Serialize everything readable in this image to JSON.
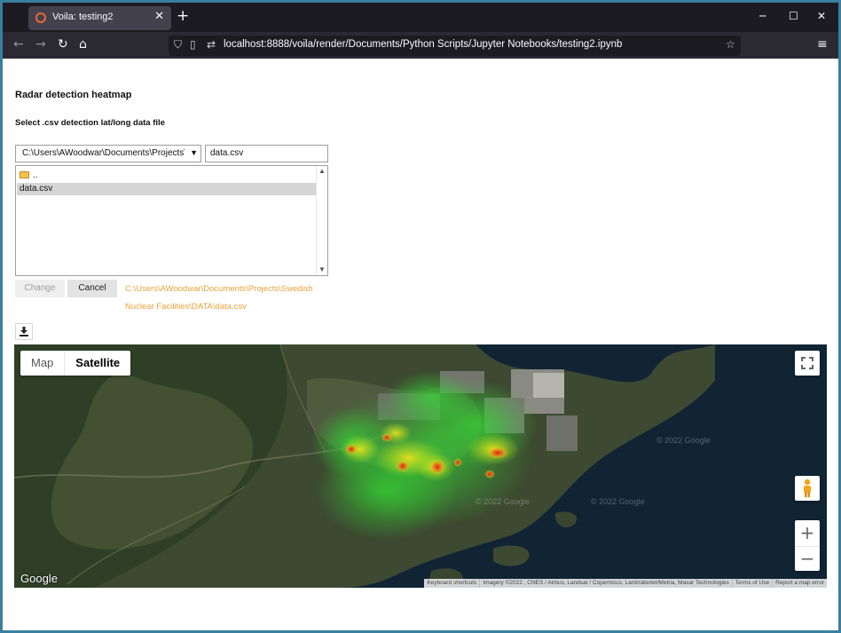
{
  "browser": {
    "tab_title": "Voila: testing2",
    "url": "localhost:8888/voila/render/Documents/Python Scripts/Jupyter Notebooks/testing2.ipynb"
  },
  "page": {
    "title": "Radar detection heatmap",
    "subtitle": "Select .csv detection lat/long data file"
  },
  "file_chooser": {
    "dir_path": "C:\\Users\\AWoodwar\\Documents\\Projects\\Swedish Nuclear Facilities\\DATA",
    "dir_path_visible": "C:\\Users\\AWoodwar\\Documents\\Projects\\Swe",
    "filename": "data.csv",
    "items": [
      {
        "label": "..",
        "type": "folder",
        "selected": false
      },
      {
        "label": "data.csv",
        "type": "file",
        "selected": true
      }
    ],
    "change_label": "Change",
    "cancel_label": "Cancel",
    "selected_path": "C:\\Users\\AWoodwar\\Documents\\Projects\\Swedish Nuclear Facilities\\DATA\\data.csv",
    "selected_path_color": "#e7a23b"
  },
  "download_button": {
    "icon": "download-icon"
  },
  "map": {
    "type_map": "Map",
    "type_satellite": "Satellite",
    "active_type": "Satellite",
    "logo": "Google",
    "watermark": "© 2022 Google",
    "attribution": [
      "Keyboard shortcuts",
      "Imagery ©2022 , CNES / Airbus, Landsat / Copernicus, Lantmäteriet/Metria, Maxar Technologies",
      "Terms of Use",
      "Report a map error"
    ],
    "zoom_in": "+",
    "zoom_out": "−",
    "heat_colors": [
      "#2fd02f",
      "#b7e61e",
      "#f2e21a",
      "#e0201b"
    ]
  }
}
